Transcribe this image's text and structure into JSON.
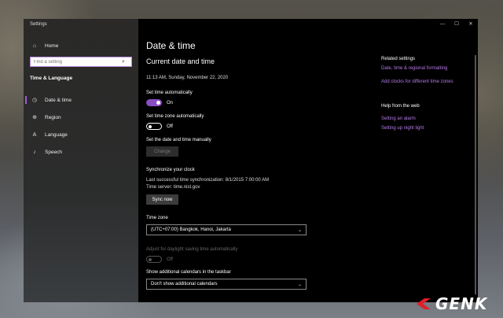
{
  "window": {
    "app_title": "Settings",
    "controls": {
      "minimize": "—",
      "maximize": "☐",
      "close": "✕"
    }
  },
  "sidebar": {
    "home_label": "Home",
    "search_placeholder": "Find a setting",
    "section": "Time & Language",
    "items": [
      {
        "label": "Date & time",
        "icon": "clock-icon",
        "active": true
      },
      {
        "label": "Region",
        "icon": "globe-icon",
        "active": false
      },
      {
        "label": "Language",
        "icon": "language-icon",
        "active": false
      },
      {
        "label": "Speech",
        "icon": "microphone-icon",
        "active": false
      }
    ]
  },
  "main": {
    "page_title": "Date & time",
    "current_heading": "Current date and time",
    "current_datetime": "11:13 AM, Sunday, November 22, 2020",
    "set_time_auto": {
      "label": "Set time automatically",
      "state": "On",
      "on": true
    },
    "set_tz_auto": {
      "label": "Set time zone automatically",
      "state": "Off",
      "on": false
    },
    "manual": {
      "label": "Set the date and time manually",
      "button": "Change"
    },
    "sync": {
      "heading": "Synchronize your clock",
      "last_sync": "Last successful time synchronization: 8/1/2015 7:00:00 AM",
      "server": "Time server: time.nist.gov",
      "button": "Sync now"
    },
    "time_zone": {
      "label": "Time zone",
      "value": "(UTC+07:00) Bangkok, Hanoi, Jakarta"
    },
    "daylight": {
      "label": "Adjust for daylight saving time automatically",
      "state": "Off",
      "enabled": false
    },
    "calendars": {
      "label": "Show additional calendars in the taskbar",
      "value": "Don't show additional calendars"
    }
  },
  "related": {
    "heading": "Related settings",
    "links": [
      "Date, time & regional formatting",
      "Add clocks for different time zones"
    ],
    "help_heading": "Help from the web",
    "help_links": [
      "Setting an alarm",
      "Setting up night light"
    ]
  },
  "watermark": {
    "text": "GENK"
  },
  "colors": {
    "accent": "#8a4cc2",
    "link": "#b678e8",
    "background": "#000000"
  }
}
